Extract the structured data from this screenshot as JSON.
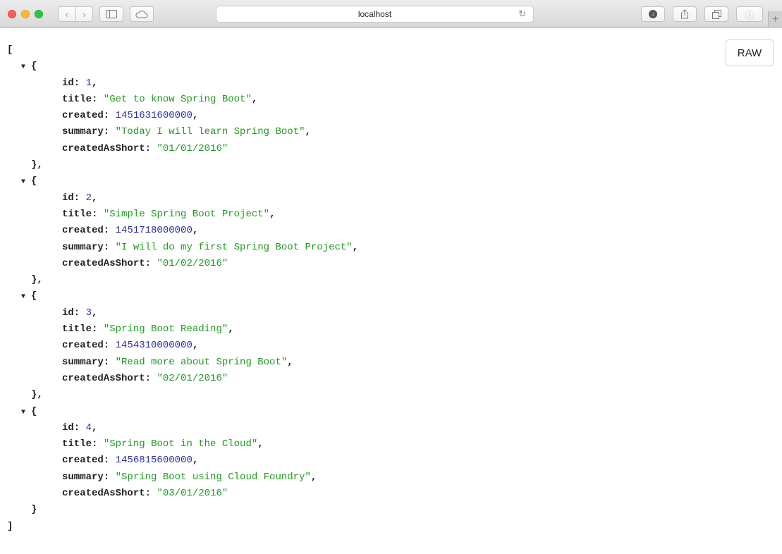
{
  "browser": {
    "address": "localhost",
    "raw_label": "RAW"
  },
  "records": [
    {
      "id": "1",
      "title": "\"Get to know Spring Boot\"",
      "created": "1451631600000",
      "summary": "\"Today I will learn Spring Boot\"",
      "createdAsShort": "\"01/01/2016\""
    },
    {
      "id": "2",
      "title": "\"Simple Spring Boot Project\"",
      "created": "1451718000000",
      "summary": "\"I will do my first Spring Boot Project\"",
      "createdAsShort": "\"01/02/2016\""
    },
    {
      "id": "3",
      "title": "\"Spring Boot Reading\"",
      "created": "1454310000000",
      "summary": "\"Read more about Spring Boot\"",
      "createdAsShort": "\"02/01/2016\""
    },
    {
      "id": "4",
      "title": "\"Spring Boot in the Cloud\"",
      "created": "1456815600000",
      "summary": "\"Spring Boot using Cloud Foundry\"",
      "createdAsShort": "\"03/01/2016\""
    }
  ],
  "keys": {
    "id": "id:",
    "title": "title:",
    "created": "created:",
    "summary": "summary:",
    "createdAsShort": "createdAsShort:"
  }
}
